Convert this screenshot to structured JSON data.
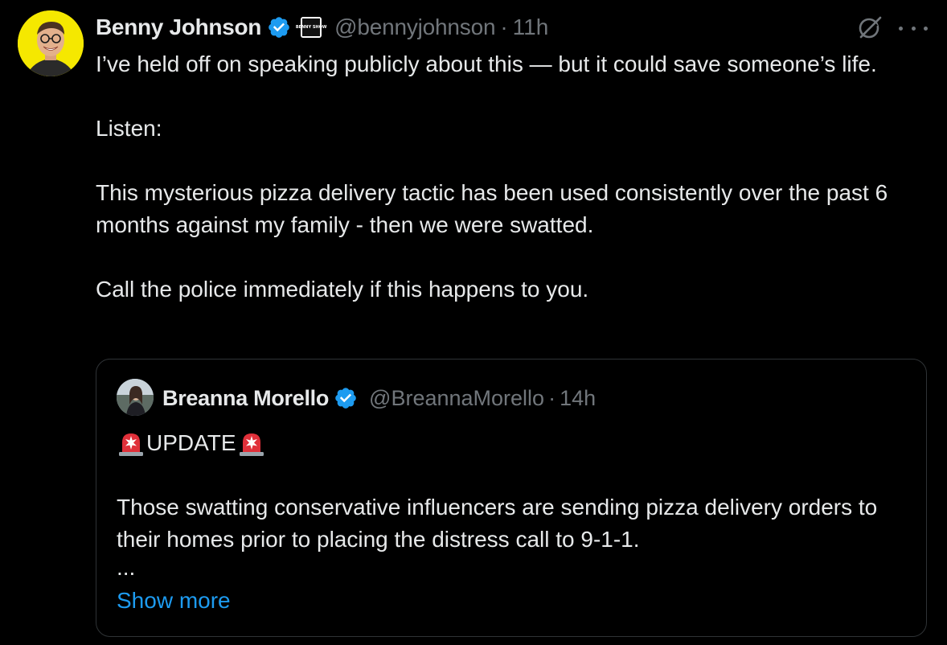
{
  "tweet": {
    "author_name": "Benny Johnson",
    "author_handle": "@bennyjohnson",
    "separator": "·",
    "time": "11h",
    "affiliate_badge_text": "BENNY SHOW",
    "body": [
      "I’ve held off on speaking publicly about this — but it could save someone’s life.",
      "Listen:",
      "This mysterious pizza delivery tactic has been used consistently over the past 6 months against my family - then we were swatted.",
      "Call the police immediately if this happens to you."
    ]
  },
  "quoted_tweet": {
    "author_name": "Breanna Morello",
    "author_handle": "@BreannaMorello",
    "separator": "·",
    "time": "14h",
    "title": "UPDATE",
    "body": "Those swatting conservative influencers are sending pizza delivery orders to their homes prior to placing the distress call to 9-1-1.",
    "ellipsis": "...",
    "show_more": "Show more"
  },
  "icons": {
    "verified": "verified-badge-icon",
    "grok": "grok-icon",
    "more": "more-options-icon",
    "siren": "police-siren-icon"
  },
  "colors": {
    "background": "#000000",
    "text": "#e7e9ea",
    "secondary": "#71767b",
    "accent": "#1d9bf0",
    "border": "#2f3336",
    "avatar_bg": "#f5e800"
  }
}
